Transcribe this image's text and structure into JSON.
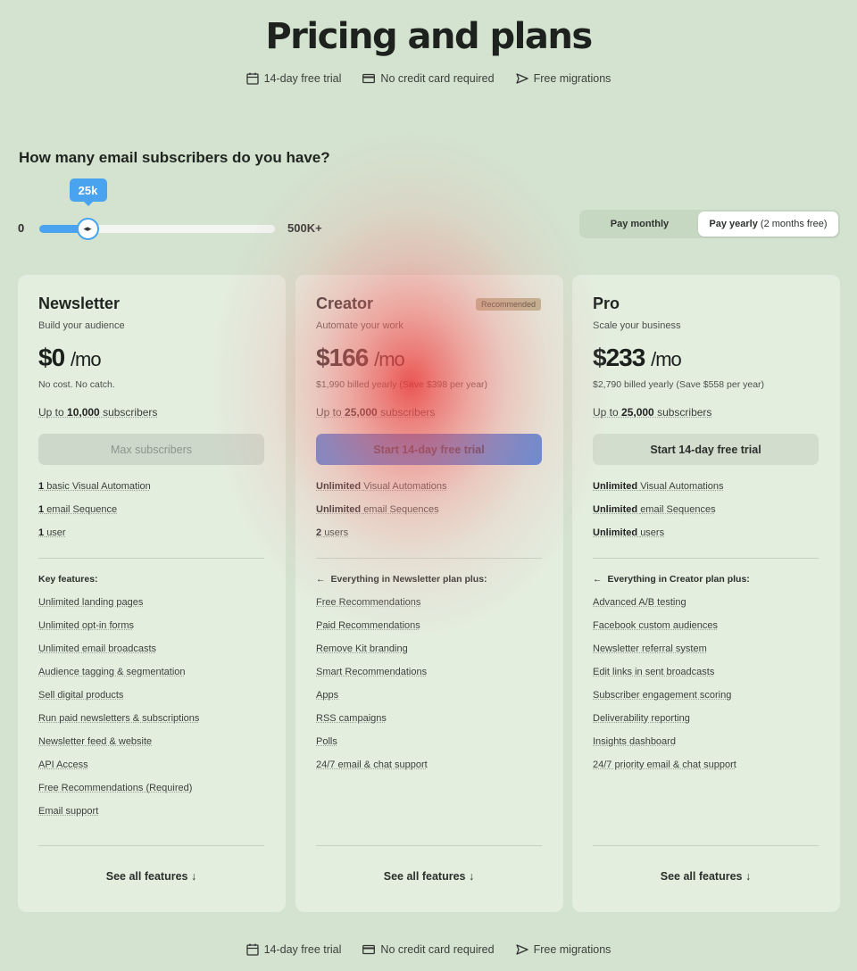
{
  "title": "Pricing and plans",
  "perks": [
    "14-day free trial",
    "No credit card required",
    "Free migrations"
  ],
  "question": "How many email subscribers do you have?",
  "slider": {
    "min": "0",
    "max": "500K+",
    "value": "25k",
    "fraction": 0.05,
    "accent": "#4aa3ef"
  },
  "billing": {
    "monthly": "Pay monthly",
    "yearly_main": "Pay yearly",
    "yearly_extra": "(2 months free)",
    "selected": "yearly"
  },
  "plans": [
    {
      "name": "Newsletter",
      "tagline": "Build your audience",
      "price": "$0",
      "per": "/mo",
      "note": "No cost. No catch.",
      "subs_pre": "Up to",
      "subs_num": "10,000",
      "subs_post": "subscribers",
      "cta": "Max subscribers",
      "limits": [
        {
          "b": "1",
          "t": "basic Visual Automation"
        },
        {
          "b": "1",
          "t": "email Sequence"
        },
        {
          "b": "1",
          "t": "user"
        }
      ],
      "feature_head": "Key features:",
      "features": [
        "Unlimited landing pages",
        "Unlimited opt-in forms",
        "Unlimited email broadcasts",
        "Audience tagging & segmentation",
        "Sell digital products",
        "Run paid newsletters & subscriptions",
        "Newsletter feed & website",
        "API Access",
        "Free Recommendations (Required)",
        "Email support"
      ],
      "see_all": "See all features"
    },
    {
      "name": "Creator",
      "tagline": "Automate your work",
      "badge": "Recommended",
      "price": "$166",
      "per": "/mo",
      "note": "$1,990 billed yearly (Save $398 per year)",
      "subs_pre": "Up to",
      "subs_num": "25,000",
      "subs_post": "subscribers",
      "cta": "Start 14-day free trial",
      "limits": [
        {
          "b": "Unlimited",
          "t": "Visual Automations"
        },
        {
          "b": "Unlimited",
          "t": "email Sequences"
        },
        {
          "b": "2",
          "t": "users"
        }
      ],
      "feature_head": "Everything in Newsletter plan plus:",
      "features": [
        "Free Recommendations",
        "Paid Recommendations",
        "Remove Kit branding",
        "Smart Recommendations",
        "Apps",
        "RSS campaigns",
        "Polls",
        "24/7 email & chat support"
      ],
      "see_all": "See all features"
    },
    {
      "name": "Pro",
      "tagline": "Scale your business",
      "price": "$233",
      "per": "/mo",
      "note": "$2,790 billed yearly (Save $558 per year)",
      "subs_pre": "Up to",
      "subs_num": "25,000",
      "subs_post": "subscribers",
      "cta": "Start 14-day free trial",
      "limits": [
        {
          "b": "Unlimited",
          "t": "Visual Automations"
        },
        {
          "b": "Unlimited",
          "t": "email Sequences"
        },
        {
          "b": "Unlimited",
          "t": "users"
        }
      ],
      "feature_head": "Everything in Creator plan plus:",
      "features": [
        "Advanced A/B testing",
        "Facebook custom audiences",
        "Newsletter referral system",
        "Edit links in sent broadcasts",
        "Subscriber engagement scoring",
        "Deliverability reporting",
        "Insights dashboard",
        "24/7 priority email & chat support"
      ],
      "see_all": "See all features"
    }
  ]
}
